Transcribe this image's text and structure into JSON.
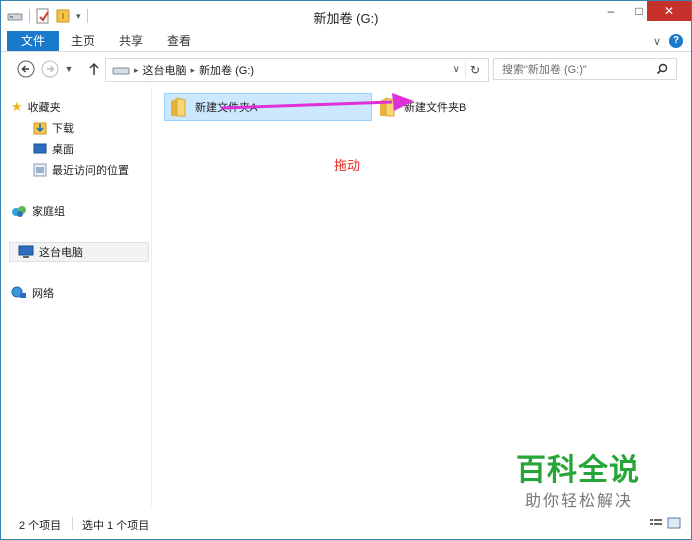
{
  "window": {
    "title": "新加卷 (G:)",
    "minimize_glyph": "–",
    "maximize_glyph": "□",
    "close_glyph": "✕"
  },
  "ribbon": {
    "tabs": [
      "文件",
      "主页",
      "共享",
      "查看"
    ],
    "expand_glyph": "∨",
    "help_glyph": "?"
  },
  "address": {
    "breadcrumb": [
      "这台电脑",
      "新加卷 (G:)"
    ],
    "separator_glyph": "▸",
    "dropdown_glyph": "∨",
    "refresh_glyph": "↻"
  },
  "search": {
    "placeholder": "搜索\"新加卷 (G:)\"",
    "icon": "search-icon"
  },
  "navpane": {
    "favorites": "收藏夹",
    "downloads": "下载",
    "desktop": "桌面",
    "recent": "最近访问的位置",
    "homegroup": "家庭组",
    "thispc": "这台电脑",
    "network": "网络"
  },
  "files": [
    {
      "name": "新建文件夹A",
      "selected": true
    },
    {
      "name": "新建文件夹B",
      "selected": false
    }
  ],
  "annotation": {
    "drag_label": "拖动",
    "arrow_color": "#e030d8"
  },
  "status": {
    "item_count": "2 个项目",
    "selected_count": "选中 1 个项目"
  },
  "watermark": {
    "title": "百科全说",
    "subtitle": "助你轻松解决"
  },
  "colors": {
    "accent": "#1979ca",
    "close": "#c7312b",
    "selection": "#cce8ff",
    "watermark": "#27a538"
  }
}
